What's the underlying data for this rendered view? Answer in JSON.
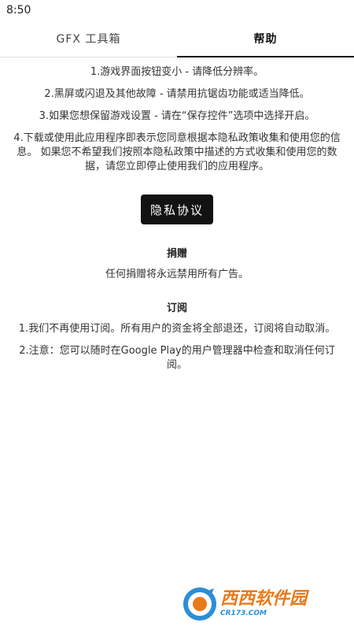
{
  "status_bar": {
    "time": "8:50"
  },
  "tabs": [
    {
      "label": "GFX 工具箱",
      "active": false
    },
    {
      "label": "帮助",
      "active": true
    }
  ],
  "help": {
    "items": [
      "1.游戏界面按钮变小 - 请降低分辨率。",
      "2.黑屏或闪退及其他故障 - 请禁用抗锯齿功能或适当降低。",
      "3.如果您想保留游戏设置 - 请在“保存控件”选项中选择开启。",
      "4.下载或使用此应用程序即表示您同意根据本隐私政策收集和使用您的信息。 如果您不希望我们按照本隐私政策中描述的方式收集和使用您的数据，请您立即停止使用我们的应用程序。"
    ],
    "privacy_button": "隐私协议"
  },
  "donate": {
    "title": "捐赠",
    "text": "任何捐赠将永远禁用所有广告。"
  },
  "subscription": {
    "title": "订阅",
    "items": [
      "1.我们不再使用订阅。所有用户的资金将全部退还，订阅将自动取消。",
      "2.注意：您可以随时在Google Play的用户管理器中检查和取消任何订阅。"
    ]
  },
  "watermark": {
    "text": "西西软件园",
    "url": "CR173.COM",
    "colors": {
      "primary": "#e97a1a",
      "secondary": "#2a8fd8"
    }
  }
}
